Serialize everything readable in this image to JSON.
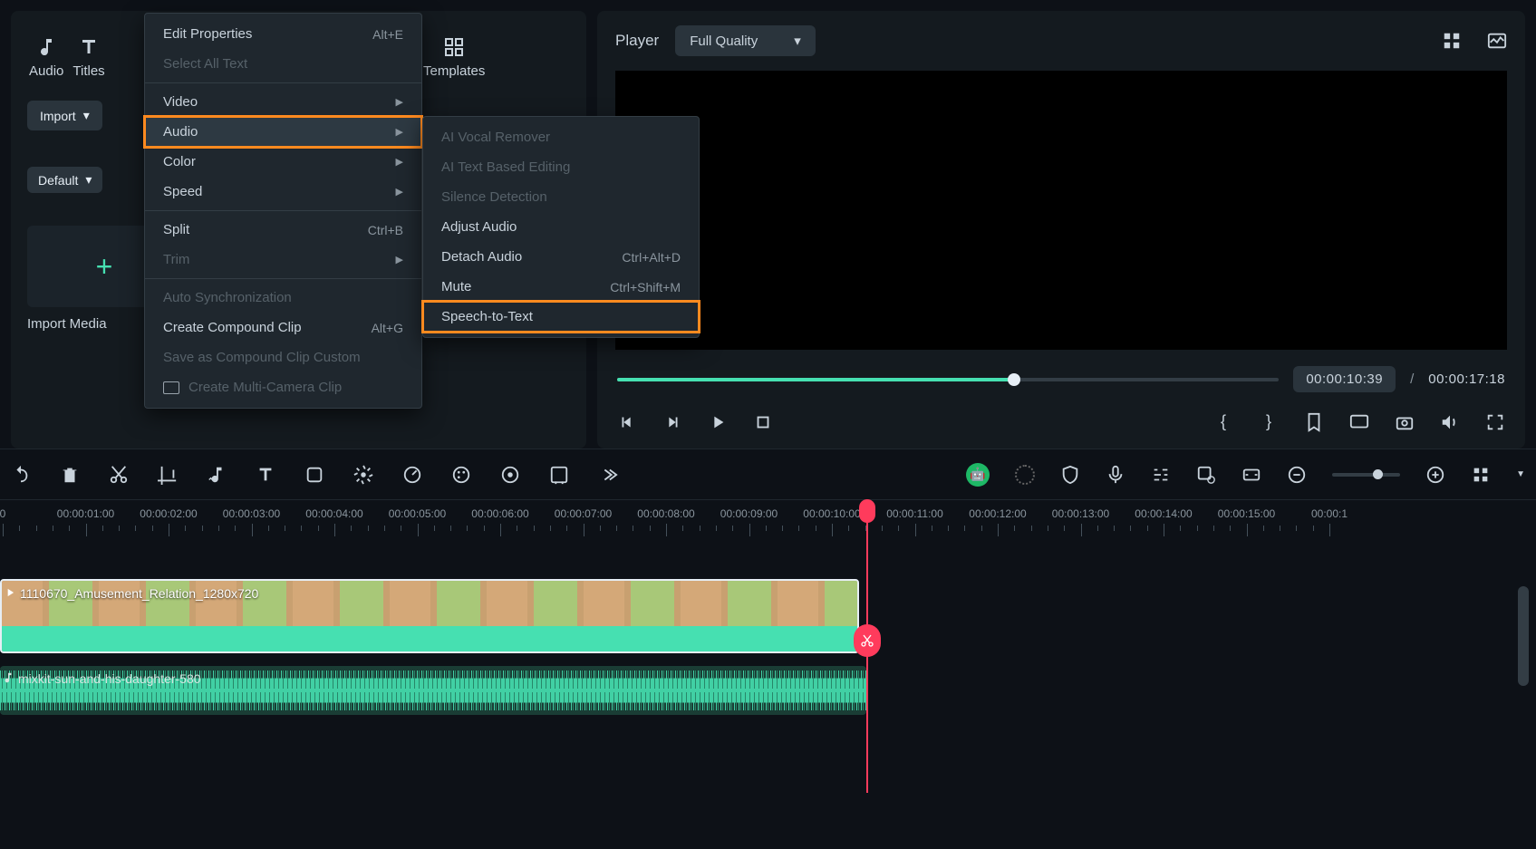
{
  "nav_tabs": {
    "audio": "Audio",
    "titles": "Titles",
    "templates": "Templates"
  },
  "import": {
    "button": "Import",
    "default": "Default",
    "import_media": "Import Media"
  },
  "context_menu": {
    "edit_properties": "Edit Properties",
    "edit_properties_sc": "Alt+E",
    "select_all_text": "Select All Text",
    "video": "Video",
    "audio": "Audio",
    "color": "Color",
    "speed": "Speed",
    "split": "Split",
    "split_sc": "Ctrl+B",
    "trim": "Trim",
    "auto_sync": "Auto Synchronization",
    "create_compound": "Create Compound Clip",
    "create_compound_sc": "Alt+G",
    "save_compound": "Save as Compound Clip Custom",
    "multi_camera": "Create Multi-Camera Clip"
  },
  "audio_submenu": {
    "vocal_remover": "AI Vocal Remover",
    "text_based": "AI Text Based Editing",
    "silence": "Silence Detection",
    "adjust": "Adjust Audio",
    "detach": "Detach Audio",
    "detach_sc": "Ctrl+Alt+D",
    "mute": "Mute",
    "mute_sc": "Ctrl+Shift+M",
    "stt": "Speech-to-Text"
  },
  "player": {
    "label": "Player",
    "quality": "Full Quality",
    "current_time": "00:00:10:39",
    "total_time": "00:00:17:18"
  },
  "timeline": {
    "labels": [
      "0",
      "00:00:01:00",
      "00:00:02:00",
      "00:00:03:00",
      "00:00:04:00",
      "00:00:05:00",
      "00:00:06:00",
      "00:00:07:00",
      "00:00:08:00",
      "00:00:09:00",
      "00:00:10:00",
      "00:00:11:00",
      "00:00:12:00",
      "00:00:13:00",
      "00:00:14:00",
      "00:00:15:00",
      "00:00:1"
    ],
    "video_clip": "1110670_Amusement_Relation_1280x720",
    "audio_clip": "mixkit-sun-and-his-daughter-580"
  }
}
